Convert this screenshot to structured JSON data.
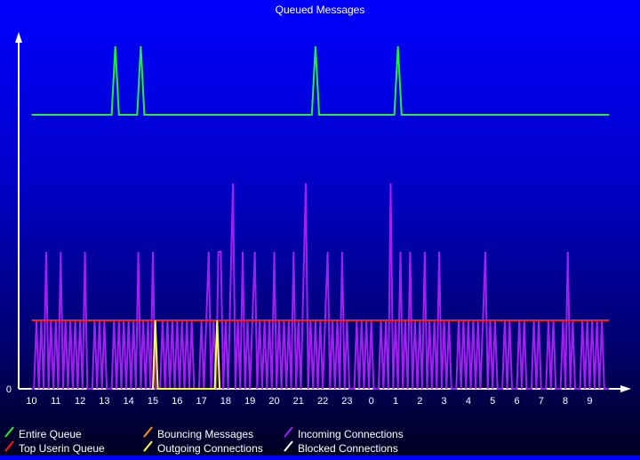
{
  "chart_data": {
    "type": "line",
    "title": "Queued Messages",
    "xlabel": "",
    "ylabel": "",
    "x_ticks": [
      "10",
      "11",
      "12",
      "13",
      "14",
      "15",
      "16",
      "17",
      "18",
      "19",
      "20",
      "21",
      "22",
      "23",
      "0",
      "1",
      "2",
      "3",
      "4",
      "5",
      "6",
      "7",
      "8",
      "9"
    ],
    "y_ticks": [
      "0"
    ],
    "grid": false,
    "legend_placement": "bottom-left",
    "ylim": [
      0,
      5.2
    ],
    "series": [
      {
        "name": "Entire Queue",
        "color": "#22ee33",
        "points": [
          [
            0,
            4
          ],
          [
            3.3,
            4
          ],
          [
            3.45,
            5
          ],
          [
            3.6,
            4
          ],
          [
            4.35,
            4
          ],
          [
            4.5,
            5
          ],
          [
            4.65,
            4
          ],
          [
            11.55,
            4
          ],
          [
            11.7,
            5
          ],
          [
            11.85,
            4
          ],
          [
            14.95,
            4
          ],
          [
            15.1,
            5
          ],
          [
            15.25,
            4
          ],
          [
            23.8,
            4
          ]
        ]
      },
      {
        "name": "Top Userin Queue",
        "color": "#ff1a1a",
        "points": [
          [
            0,
            1
          ],
          [
            23.8,
            1
          ]
        ]
      },
      {
        "name": "Bouncing Messages",
        "color": "#ff9900",
        "points": []
      },
      {
        "name": "Outgoing Connections",
        "color": "#ffff33",
        "points": [
          [
            5.0,
            0
          ],
          [
            5.1,
            1
          ],
          [
            5.2,
            0
          ],
          [
            7.55,
            0
          ],
          [
            7.65,
            1
          ],
          [
            7.75,
            0
          ]
        ]
      },
      {
        "name": "Incoming Connections",
        "color": "#a020f0",
        "points": [
          [
            0,
            0
          ],
          [
            0.1,
            0
          ],
          [
            0.2,
            1
          ],
          [
            0.3,
            0
          ],
          [
            0.4,
            1
          ],
          [
            0.5,
            0
          ],
          [
            0.6,
            2
          ],
          [
            0.7,
            0
          ],
          [
            0.8,
            1
          ],
          [
            0.9,
            0
          ],
          [
            1.0,
            1
          ],
          [
            1.1,
            0
          ],
          [
            1.2,
            2
          ],
          [
            1.3,
            0
          ],
          [
            1.4,
            1
          ],
          [
            1.5,
            0
          ],
          [
            1.6,
            1
          ],
          [
            1.7,
            0
          ],
          [
            1.8,
            1
          ],
          [
            1.9,
            0
          ],
          [
            2.0,
            1
          ],
          [
            2.1,
            0
          ],
          [
            2.2,
            2
          ],
          [
            2.3,
            0
          ],
          [
            2.5,
            0
          ],
          [
            2.6,
            1
          ],
          [
            2.7,
            0
          ],
          [
            2.8,
            1
          ],
          [
            2.9,
            0
          ],
          [
            3.0,
            1
          ],
          [
            3.1,
            0
          ],
          [
            3.3,
            0
          ],
          [
            3.4,
            1
          ],
          [
            3.5,
            0
          ],
          [
            3.6,
            1
          ],
          [
            3.7,
            0
          ],
          [
            3.8,
            1
          ],
          [
            3.9,
            0
          ],
          [
            4.0,
            1
          ],
          [
            4.1,
            0
          ],
          [
            4.2,
            1
          ],
          [
            4.3,
            0
          ],
          [
            4.4,
            2
          ],
          [
            4.5,
            0
          ],
          [
            4.6,
            1
          ],
          [
            4.7,
            0
          ],
          [
            4.8,
            1
          ],
          [
            4.9,
            0
          ],
          [
            5.0,
            2
          ],
          [
            5.1,
            0
          ],
          [
            5.3,
            0
          ],
          [
            5.4,
            1
          ],
          [
            5.5,
            0
          ],
          [
            5.6,
            1
          ],
          [
            5.7,
            0
          ],
          [
            5.8,
            1
          ],
          [
            5.9,
            0
          ],
          [
            6.0,
            1
          ],
          [
            6.1,
            0
          ],
          [
            6.2,
            1
          ],
          [
            6.3,
            0
          ],
          [
            6.4,
            1
          ],
          [
            6.5,
            0
          ],
          [
            6.6,
            1
          ],
          [
            6.7,
            0
          ],
          [
            6.9,
            0
          ],
          [
            7.0,
            1
          ],
          [
            7.1,
            0
          ],
          [
            7.2,
            1
          ],
          [
            7.3,
            2
          ],
          [
            7.4,
            0
          ],
          [
            7.5,
            1
          ],
          [
            7.6,
            0
          ],
          [
            7.7,
            2
          ],
          [
            7.8,
            2
          ],
          [
            7.9,
            0
          ],
          [
            8.0,
            1
          ],
          [
            8.1,
            0
          ],
          [
            8.3,
            3
          ],
          [
            8.4,
            0
          ],
          [
            8.5,
            1
          ],
          [
            8.6,
            0
          ],
          [
            8.7,
            2
          ],
          [
            8.8,
            0
          ],
          [
            8.9,
            1
          ],
          [
            9.0,
            0
          ],
          [
            9.2,
            2
          ],
          [
            9.3,
            0
          ],
          [
            9.4,
            1
          ],
          [
            9.5,
            0
          ],
          [
            9.6,
            1
          ],
          [
            9.7,
            0
          ],
          [
            9.8,
            1
          ],
          [
            9.9,
            0
          ],
          [
            10.0,
            2
          ],
          [
            10.1,
            0
          ],
          [
            10.2,
            1
          ],
          [
            10.3,
            0
          ],
          [
            10.4,
            1
          ],
          [
            10.5,
            0
          ],
          [
            10.6,
            1
          ],
          [
            10.7,
            0
          ],
          [
            10.8,
            2
          ],
          [
            10.9,
            0
          ],
          [
            11.0,
            1
          ],
          [
            11.1,
            0
          ],
          [
            11.3,
            3
          ],
          [
            11.4,
            0
          ],
          [
            11.5,
            1
          ],
          [
            11.6,
            0
          ],
          [
            11.7,
            1
          ],
          [
            11.8,
            0
          ],
          [
            11.9,
            1
          ],
          [
            12.0,
            0
          ],
          [
            12.1,
            1
          ],
          [
            12.2,
            2
          ],
          [
            12.3,
            0
          ],
          [
            12.4,
            1
          ],
          [
            12.5,
            0
          ],
          [
            12.6,
            1
          ],
          [
            12.7,
            0
          ],
          [
            12.8,
            2
          ],
          [
            12.9,
            0
          ],
          [
            13.0,
            1
          ],
          [
            13.1,
            0
          ],
          [
            13.3,
            0
          ],
          [
            13.4,
            1
          ],
          [
            13.5,
            0
          ],
          [
            13.6,
            1
          ],
          [
            13.7,
            0
          ],
          [
            13.8,
            1
          ],
          [
            13.9,
            0
          ],
          [
            14.0,
            1
          ],
          [
            14.1,
            0
          ],
          [
            14.3,
            0
          ],
          [
            14.4,
            1
          ],
          [
            14.5,
            0
          ],
          [
            14.6,
            1
          ],
          [
            14.7,
            0
          ],
          [
            14.8,
            3
          ],
          [
            14.9,
            0
          ],
          [
            15.0,
            1
          ],
          [
            15.1,
            0
          ],
          [
            15.2,
            2
          ],
          [
            15.3,
            0
          ],
          [
            15.4,
            1
          ],
          [
            15.5,
            0
          ],
          [
            15.6,
            2
          ],
          [
            15.7,
            0
          ],
          [
            15.8,
            1
          ],
          [
            15.9,
            0
          ],
          [
            16.0,
            1
          ],
          [
            16.1,
            0
          ],
          [
            16.2,
            2
          ],
          [
            16.3,
            0
          ],
          [
            16.4,
            1
          ],
          [
            16.5,
            0
          ],
          [
            16.6,
            1
          ],
          [
            16.7,
            0
          ],
          [
            16.8,
            2
          ],
          [
            16.9,
            0
          ],
          [
            17.0,
            1
          ],
          [
            17.1,
            0
          ],
          [
            17.2,
            1
          ],
          [
            17.3,
            0
          ],
          [
            17.5,
            0
          ],
          [
            17.6,
            1
          ],
          [
            17.7,
            0
          ],
          [
            17.8,
            1
          ],
          [
            17.9,
            0
          ],
          [
            18.0,
            1
          ],
          [
            18.1,
            0
          ],
          [
            18.2,
            1
          ],
          [
            18.3,
            0
          ],
          [
            18.4,
            1
          ],
          [
            18.5,
            0
          ],
          [
            18.6,
            1
          ],
          [
            18.7,
            2
          ],
          [
            18.8,
            0
          ],
          [
            18.9,
            1
          ],
          [
            19.0,
            0
          ],
          [
            19.1,
            1
          ],
          [
            19.2,
            0
          ],
          [
            19.4,
            0
          ],
          [
            19.5,
            1
          ],
          [
            19.6,
            0
          ],
          [
            19.7,
            1
          ],
          [
            19.8,
            0
          ],
          [
            20.0,
            0
          ],
          [
            20.1,
            1
          ],
          [
            20.2,
            0
          ],
          [
            20.3,
            1
          ],
          [
            20.4,
            0
          ],
          [
            20.6,
            0
          ],
          [
            20.7,
            1
          ],
          [
            20.8,
            0
          ],
          [
            20.9,
            1
          ],
          [
            21.0,
            0
          ],
          [
            21.2,
            0
          ],
          [
            21.3,
            1
          ],
          [
            21.4,
            0
          ],
          [
            21.5,
            1
          ],
          [
            21.6,
            0
          ],
          [
            21.8,
            0
          ],
          [
            21.9,
            1
          ],
          [
            22.0,
            0
          ],
          [
            22.1,
            2
          ],
          [
            22.2,
            0
          ],
          [
            22.3,
            1
          ],
          [
            22.4,
            0
          ],
          [
            22.6,
            0
          ],
          [
            22.7,
            1
          ],
          [
            22.8,
            0
          ],
          [
            22.9,
            1
          ],
          [
            23.0,
            0
          ],
          [
            23.1,
            1
          ],
          [
            23.2,
            0
          ],
          [
            23.3,
            1
          ],
          [
            23.4,
            0
          ],
          [
            23.5,
            1
          ],
          [
            23.6,
            0
          ],
          [
            23.8,
            0
          ]
        ]
      },
      {
        "name": "Blocked Connections",
        "color": "#ffffff",
        "points": []
      }
    ]
  }
}
